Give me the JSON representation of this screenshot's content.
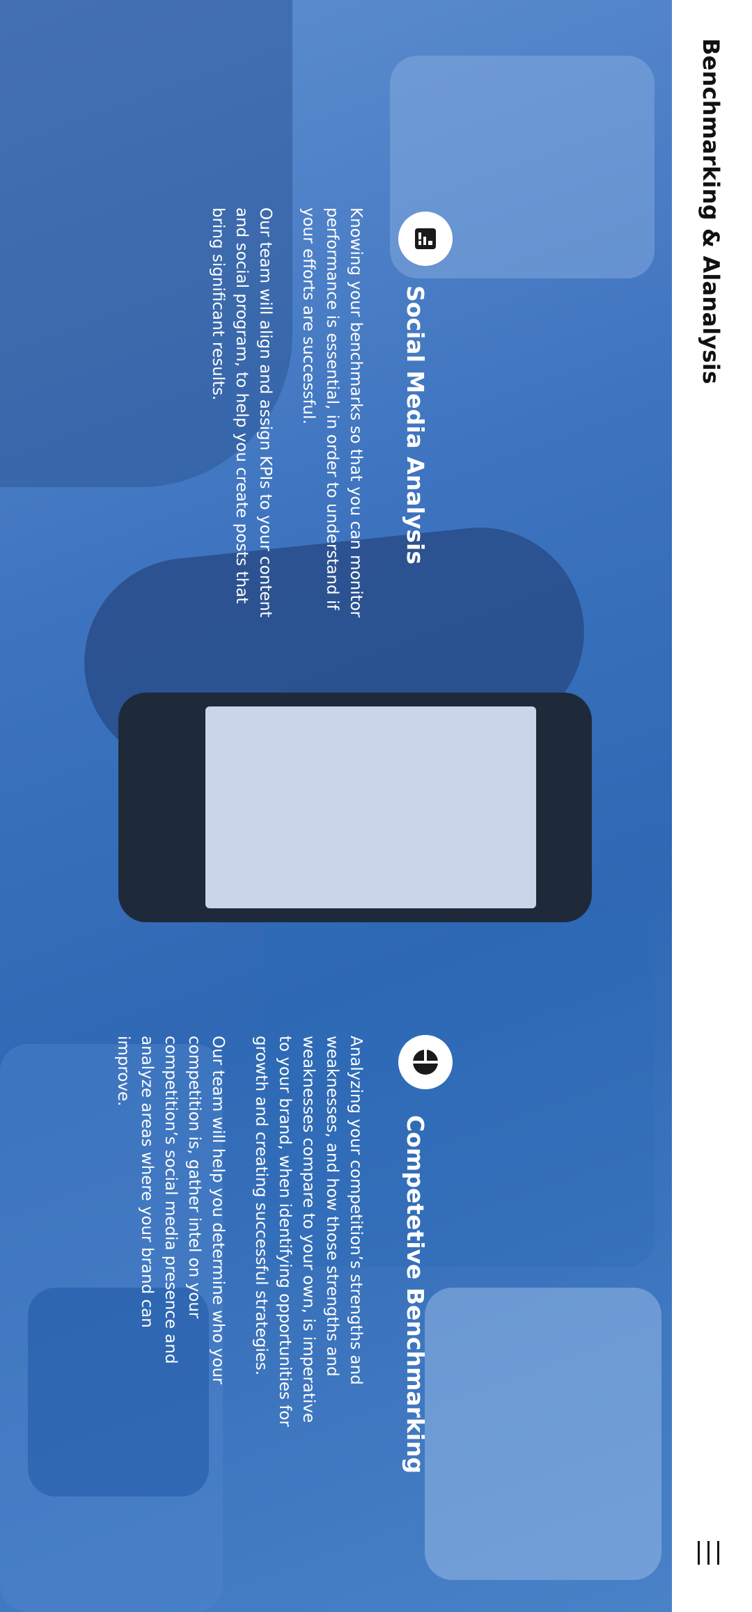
{
  "header": {
    "title": "Benchmarking & Alanalysis",
    "menu_icon": "menu-icon"
  },
  "sections": [
    {
      "icon": "chart-icon",
      "heading": "Social Media Analysis",
      "paragraphs": [
        "Knowing your benchmarks so that you can monitor performance is essential, in order to understand if your efforts are successful.",
        "Our team will align and assign KPIs to your content and social program, to help you create posts that bring significant results."
      ]
    },
    {
      "icon": "pie-chart-icon",
      "heading": "Competetive Benchmarking",
      "paragraphs": [
        "Analyzing your competition’s strengths and weaknesses, and how those strengths and weaknesses compare to your own, is imperative to your brand, when identifying opportunities for growth and creating successful strategies.",
        "Our team will help you determine who your competition is, gather intel on your competition’s social media presence and analyze areas where your brand can improve."
      ]
    }
  ],
  "colors": {
    "overlay_blue": "#3a72bf",
    "text_light": "#ffffff",
    "text_dark": "#111111"
  }
}
